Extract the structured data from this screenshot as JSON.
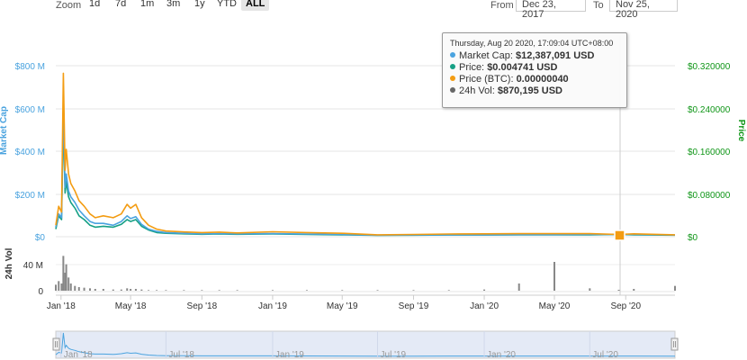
{
  "toolbar": {
    "zoom_label": "Zoom",
    "zoom_buttons": [
      "1d",
      "7d",
      "1m",
      "3m",
      "1y",
      "YTD",
      "ALL"
    ],
    "active_zoom": "ALL",
    "from_label": "From",
    "from_value": "Dec 23, 2017",
    "to_label": "To",
    "to_value": "Nov 25, 2020"
  },
  "tooltip": {
    "header": "Thursday, Aug 20 2020, 17:09:04 UTC+08:00",
    "rows": [
      {
        "label": "Market Cap:",
        "value": "$12,387,091 USD",
        "color": "#4aa3df"
      },
      {
        "label": "Price:",
        "value": "$0.004741 USD",
        "color": "#16a085"
      },
      {
        "label": "Price (BTC):",
        "value": "0.00000040",
        "color": "#f39c12"
      },
      {
        "label": "24h Vol:",
        "value": "$870,195 USD",
        "color": "#666666"
      }
    ]
  },
  "colors": {
    "market_cap": "#4aa3df",
    "price": "#16a085",
    "price_btc": "#f39c12",
    "volume": "#888888",
    "navigator_fill": "#e4eaf6",
    "left_axis": "#4aa3df",
    "right_axis": "#109618"
  },
  "chart_data": {
    "type": "line",
    "x_ticks": [
      "Jan '18",
      "May '18",
      "Sep '18",
      "Jan '19",
      "May '19",
      "Sep '19",
      "Jan '20",
      "May '20",
      "Sep '20"
    ],
    "left_axis": {
      "label": "Market Cap",
      "ticks": [
        "$0",
        "$200 M",
        "$400 M",
        "$600 M",
        "$800 M"
      ],
      "range": [
        0,
        900
      ]
    },
    "right_axis": {
      "label": "Price",
      "ticks": [
        "$0",
        "$0.080000",
        "$0.160000",
        "$0.240000",
        "$0.320000"
      ],
      "range": [
        0,
        0.36
      ]
    },
    "volume_axis": {
      "label": "24h Vol",
      "ticks": [
        "0",
        "40 M"
      ]
    },
    "navigator_ticks": [
      "Jan '18",
      "Jul '18",
      "Jan '19",
      "Jul '19",
      "Jan '20",
      "Jul '20"
    ],
    "x": [
      "2017-12-23",
      "2017-12-28",
      "2018-01-02",
      "2018-01-05",
      "2018-01-08",
      "2018-01-10",
      "2018-01-14",
      "2018-01-18",
      "2018-01-25",
      "2018-02-01",
      "2018-02-10",
      "2018-02-20",
      "2018-03-01",
      "2018-03-15",
      "2018-04-01",
      "2018-04-15",
      "2018-04-25",
      "2018-05-01",
      "2018-05-10",
      "2018-05-20",
      "2018-06-01",
      "2018-06-15",
      "2018-07-01",
      "2018-08-01",
      "2018-09-01",
      "2018-10-01",
      "2018-11-01",
      "2019-01-01",
      "2019-03-01",
      "2019-05-01",
      "2019-07-01",
      "2019-09-01",
      "2019-11-01",
      "2020-01-01",
      "2020-03-01",
      "2020-05-01",
      "2020-07-01",
      "2020-08-20",
      "2020-09-15",
      "2020-11-25"
    ],
    "series": [
      {
        "name": "Price (BTC)",
        "color": "#f39c12",
        "values": [
          60,
          160,
          130,
          860,
          350,
          460,
          330,
          280,
          240,
          190,
          160,
          120,
          100,
          110,
          100,
          120,
          170,
          150,
          170,
          100,
          60,
          40,
          30,
          25,
          22,
          24,
          20,
          26,
          22,
          18,
          10,
          12,
          14,
          15,
          16,
          16,
          16,
          12,
          15,
          10
        ]
      },
      {
        "name": "Market Cap",
        "color": "#4aa3df",
        "values": [
          50,
          120,
          100,
          700,
          260,
          330,
          240,
          210,
          180,
          140,
          110,
          80,
          70,
          70,
          60,
          80,
          110,
          95,
          105,
          65,
          40,
          28,
          22,
          18,
          15,
          16,
          15,
          16,
          14,
          12,
          8,
          9,
          10,
          10,
          11,
          11,
          12,
          12,
          12,
          9
        ]
      },
      {
        "name": "Price",
        "color": "#16a085",
        "values": [
          40,
          110,
          90,
          620,
          230,
          290,
          210,
          180,
          150,
          110,
          90,
          60,
          50,
          55,
          50,
          65,
          90,
          80,
          90,
          55,
          35,
          22,
          18,
          15,
          13,
          14,
          13,
          14,
          12,
          10,
          7,
          8,
          9,
          9,
          10,
          10,
          10,
          12,
          10,
          8
        ]
      },
      {
        "name": "24h Vol",
        "color": "#888888",
        "type": "bar",
        "values": [
          10,
          16,
          12,
          58,
          30,
          44,
          22,
          12,
          8,
          6,
          5,
          4,
          3,
          3,
          2,
          2,
          4,
          3,
          3,
          2,
          1,
          1,
          1,
          1,
          1,
          1,
          1,
          1,
          1,
          1,
          1,
          1,
          1,
          2,
          12,
          48,
          4,
          1.5,
          3,
          8
        ]
      }
    ]
  }
}
